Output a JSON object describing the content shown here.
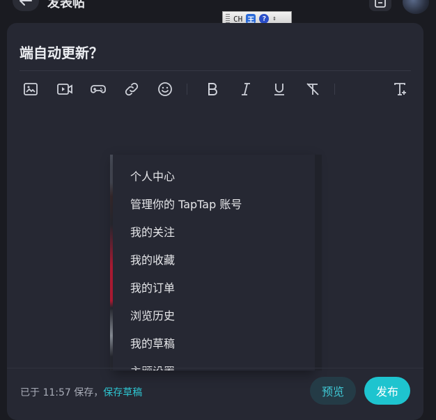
{
  "header": {
    "title": "发表帖",
    "back_icon": "arrow-left-icon",
    "draft_icon": "document-icon",
    "avatar_icon": "user-avatar"
  },
  "ime_toolbar": {
    "mode_label": "CH",
    "engine_icon": "ime-logo-icon",
    "engine_glyph": "王",
    "help_glyph": "?"
  },
  "post": {
    "title": "端自动更新？"
  },
  "toolbar": {
    "tools": [
      {
        "name": "image-icon"
      },
      {
        "name": "video-icon"
      },
      {
        "name": "gamepad-icon"
      },
      {
        "name": "link-icon"
      },
      {
        "name": "emoji-icon"
      },
      {
        "name": "bold-icon"
      },
      {
        "name": "italic-icon"
      },
      {
        "name": "underline-icon"
      },
      {
        "name": "clear-format-icon"
      },
      {
        "name": "text-add-icon"
      }
    ]
  },
  "user_menu": {
    "items": [
      {
        "label": "个人中心"
      },
      {
        "label": "管理你的 TapTap 账号"
      },
      {
        "label": "我的关注"
      },
      {
        "label": "我的收藏"
      },
      {
        "label": "我的订单"
      },
      {
        "label": "浏览历史"
      },
      {
        "label": "我的草稿"
      },
      {
        "label": "主题设置"
      }
    ]
  },
  "footer": {
    "saved_text": "已于 11:57 保存，",
    "save_draft_label": "保存草稿",
    "preview_label": "预览",
    "publish_label": "发布"
  },
  "colors": {
    "accent": "#1ec4cf",
    "background": "#1a1b21",
    "card": "#262833"
  }
}
